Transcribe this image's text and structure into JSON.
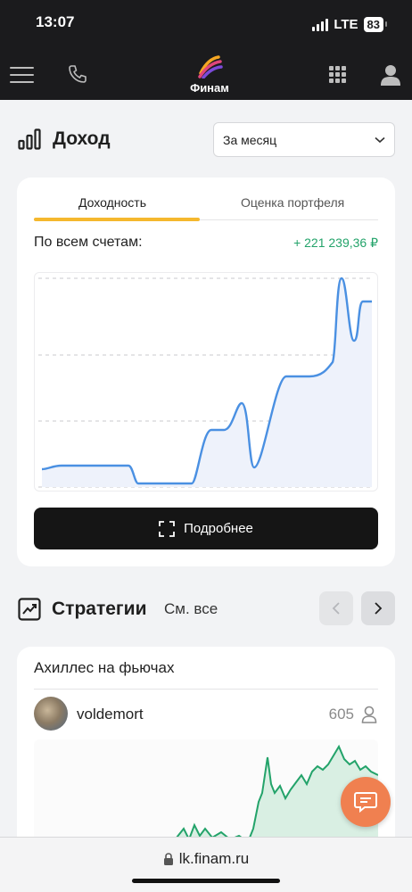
{
  "status_bar": {
    "time": "13:07",
    "network": "LTE",
    "battery": "83"
  },
  "header": {
    "logo_text": "Финам"
  },
  "income": {
    "title": "Доход",
    "period": "За месяц",
    "tabs": [
      {
        "label": "Доходность",
        "active": true
      },
      {
        "label": "Оценка портфеля",
        "active": false
      }
    ],
    "total_label": "По всем счетам:",
    "total_value": "+ 221 239,36 ₽",
    "more_button": "Подробнее"
  },
  "strategies": {
    "title": "Стратегии",
    "see_all": "См. все",
    "card": {
      "title": "Ахиллес на фьючах",
      "author": "voldemort",
      "subscribers": "605"
    }
  },
  "browser": {
    "url": "lk.finam.ru"
  },
  "colors": {
    "accent": "#f5b82e",
    "positive": "#23a36a",
    "chart_line": "#4a90e2",
    "chat_button": "#f08050"
  }
}
